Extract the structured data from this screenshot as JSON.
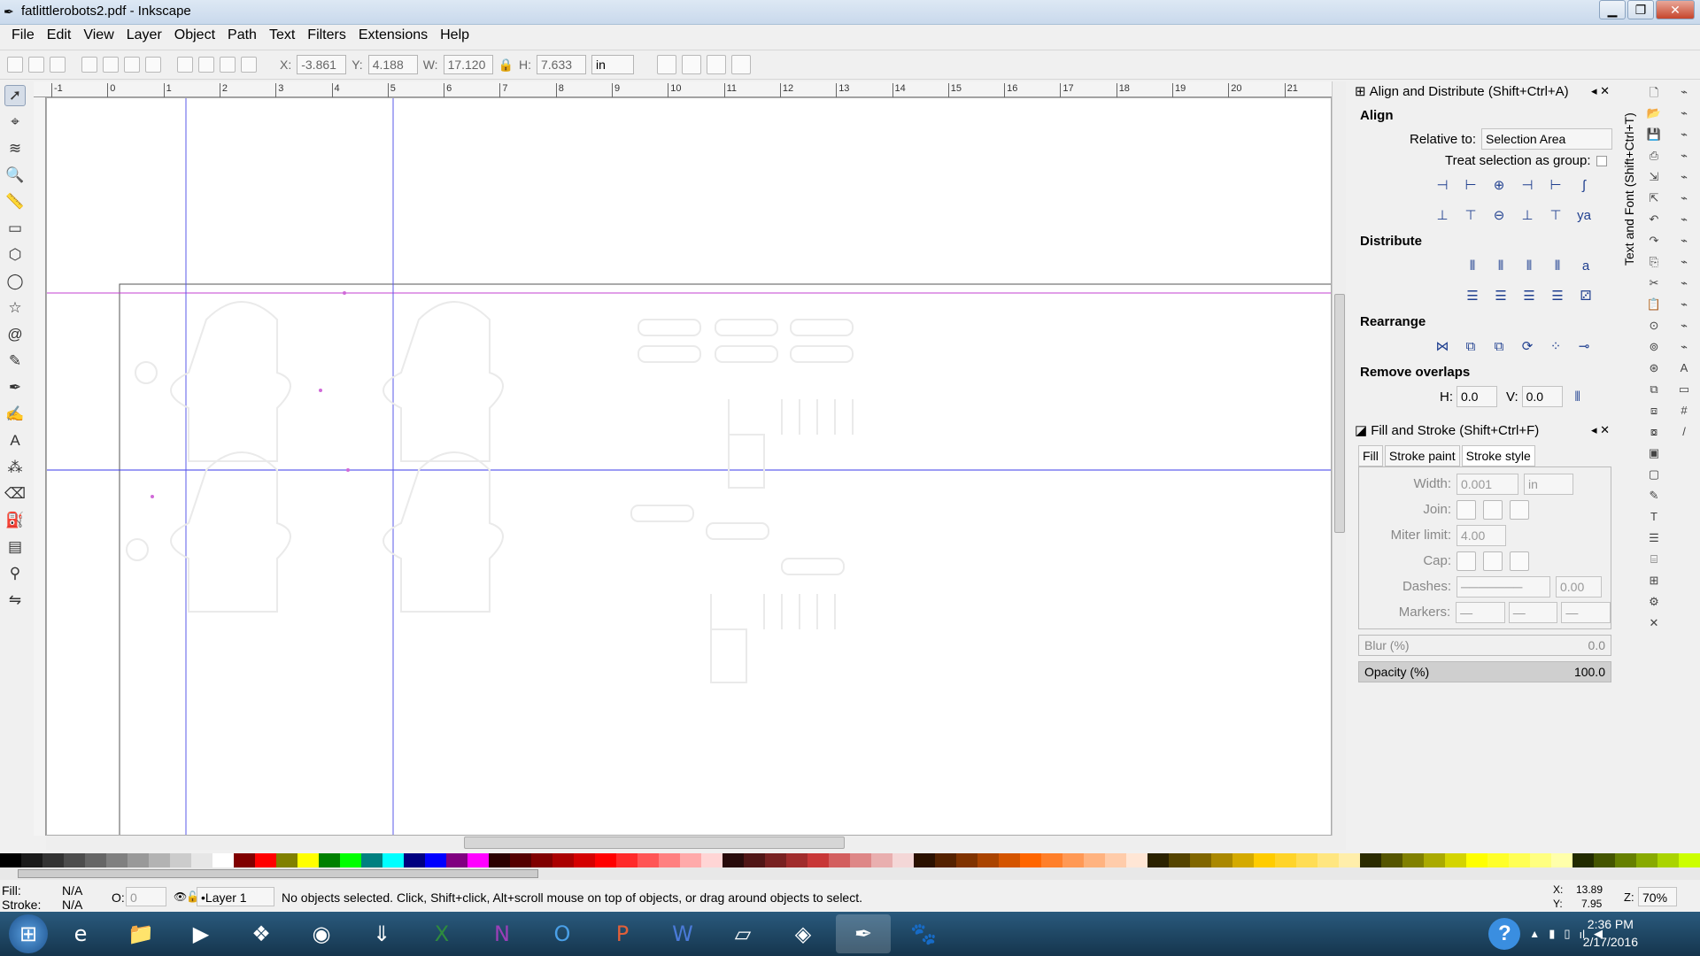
{
  "window": {
    "title": "fatlittlerobots2.pdf - Inkscape"
  },
  "menu": [
    "File",
    "Edit",
    "View",
    "Layer",
    "Object",
    "Path",
    "Text",
    "Filters",
    "Extensions",
    "Help"
  ],
  "controls": {
    "x_label": "X:",
    "x": "-3.861",
    "y_label": "Y:",
    "y": "4.188",
    "w_label": "W:",
    "w": "17.120",
    "h_label": "H:",
    "h": "7.633",
    "unit": "in"
  },
  "ruler_ticks": [
    "-1",
    "0",
    "1",
    "2",
    "3",
    "4",
    "5",
    "6",
    "7",
    "8",
    "9",
    "10",
    "11",
    "12",
    "13",
    "14",
    "15",
    "16",
    "17",
    "18",
    "19",
    "20",
    "21"
  ],
  "align_panel": {
    "title": "Align and Distribute (Shift+Ctrl+A)",
    "align": "Align",
    "relative_label": "Relative to:",
    "relative_value": "Selection Area",
    "treat_group": "Treat selection as group:",
    "distribute": "Distribute",
    "rearrange": "Rearrange",
    "remove_overlaps": "Remove overlaps",
    "h_label": "H:",
    "h_value": "0.0",
    "v_label": "V:",
    "v_value": "0.0"
  },
  "fill_stroke_panel": {
    "title": "Fill and Stroke (Shift+Ctrl+F)",
    "tabs": [
      "Fill",
      "Stroke paint",
      "Stroke style"
    ],
    "width_label": "Width:",
    "width_value": "0.001",
    "width_unit": "in",
    "join_label": "Join:",
    "miter_label": "Miter limit:",
    "miter_value": "4.00",
    "cap_label": "Cap:",
    "dashes_label": "Dashes:",
    "dashes_value": "0.00",
    "markers_label": "Markers:",
    "blur_label": "Blur (%)",
    "blur_value": "0.0",
    "opacity_label": "Opacity (%)",
    "opacity_value": "100.0"
  },
  "text_font_tab": "Text and Font (Shift+Ctrl+T)",
  "status": {
    "fill_label": "Fill:",
    "fill_value": "N/A",
    "stroke_label": "Stroke:",
    "stroke_value": "N/A",
    "opacity_label": "O:",
    "opacity_value": "0",
    "layer": "•Layer 1",
    "message": "No objects selected. Click, Shift+click, Alt+scroll mouse on top of objects, or drag around objects to select.",
    "cursor_x_label": "X:",
    "cursor_x": "13.89",
    "cursor_y_label": "Y:",
    "cursor_y": "7.95",
    "zoom_label": "Z:",
    "zoom": "70%"
  },
  "clock": {
    "time": "2:36 PM",
    "date": "2/17/2016"
  },
  "palette_colors": [
    "#000000",
    "#1a1a1a",
    "#333333",
    "#4d4d4d",
    "#666666",
    "#808080",
    "#999999",
    "#b3b3b3",
    "#cccccc",
    "#e6e6e6",
    "#ffffff",
    "#800000",
    "#ff0000",
    "#808000",
    "#ffff00",
    "#008000",
    "#00ff00",
    "#008080",
    "#00ffff",
    "#000080",
    "#0000ff",
    "#800080",
    "#ff00ff",
    "#2b0000",
    "#550000",
    "#800000",
    "#aa0000",
    "#d40000",
    "#ff0000",
    "#ff2a2a",
    "#ff5555",
    "#ff8080",
    "#ffaaaa",
    "#ffd5d5",
    "#280b0b",
    "#501616",
    "#782121",
    "#a02c2c",
    "#c83737",
    "#d35f5f",
    "#de8787",
    "#e9afaf",
    "#f4d7d7",
    "#2b1100",
    "#552200",
    "#803300",
    "#aa4400",
    "#d45500",
    "#ff6600",
    "#ff7f2a",
    "#ff9955",
    "#ffb380",
    "#ffccaa",
    "#ffe6d5",
    "#2b2200",
    "#554400",
    "#806600",
    "#aa8800",
    "#d4aa00",
    "#ffcc00",
    "#ffd42a",
    "#ffdd55",
    "#ffe680",
    "#ffeeaa",
    "#2b2b00",
    "#555500",
    "#808000",
    "#aaaa00",
    "#d4d400",
    "#ffff00",
    "#ffff2a",
    "#ffff55",
    "#ffff80",
    "#ffffaa",
    "#222b00",
    "#445500",
    "#668000",
    "#88aa00",
    "#aad400",
    "#ccff00"
  ]
}
